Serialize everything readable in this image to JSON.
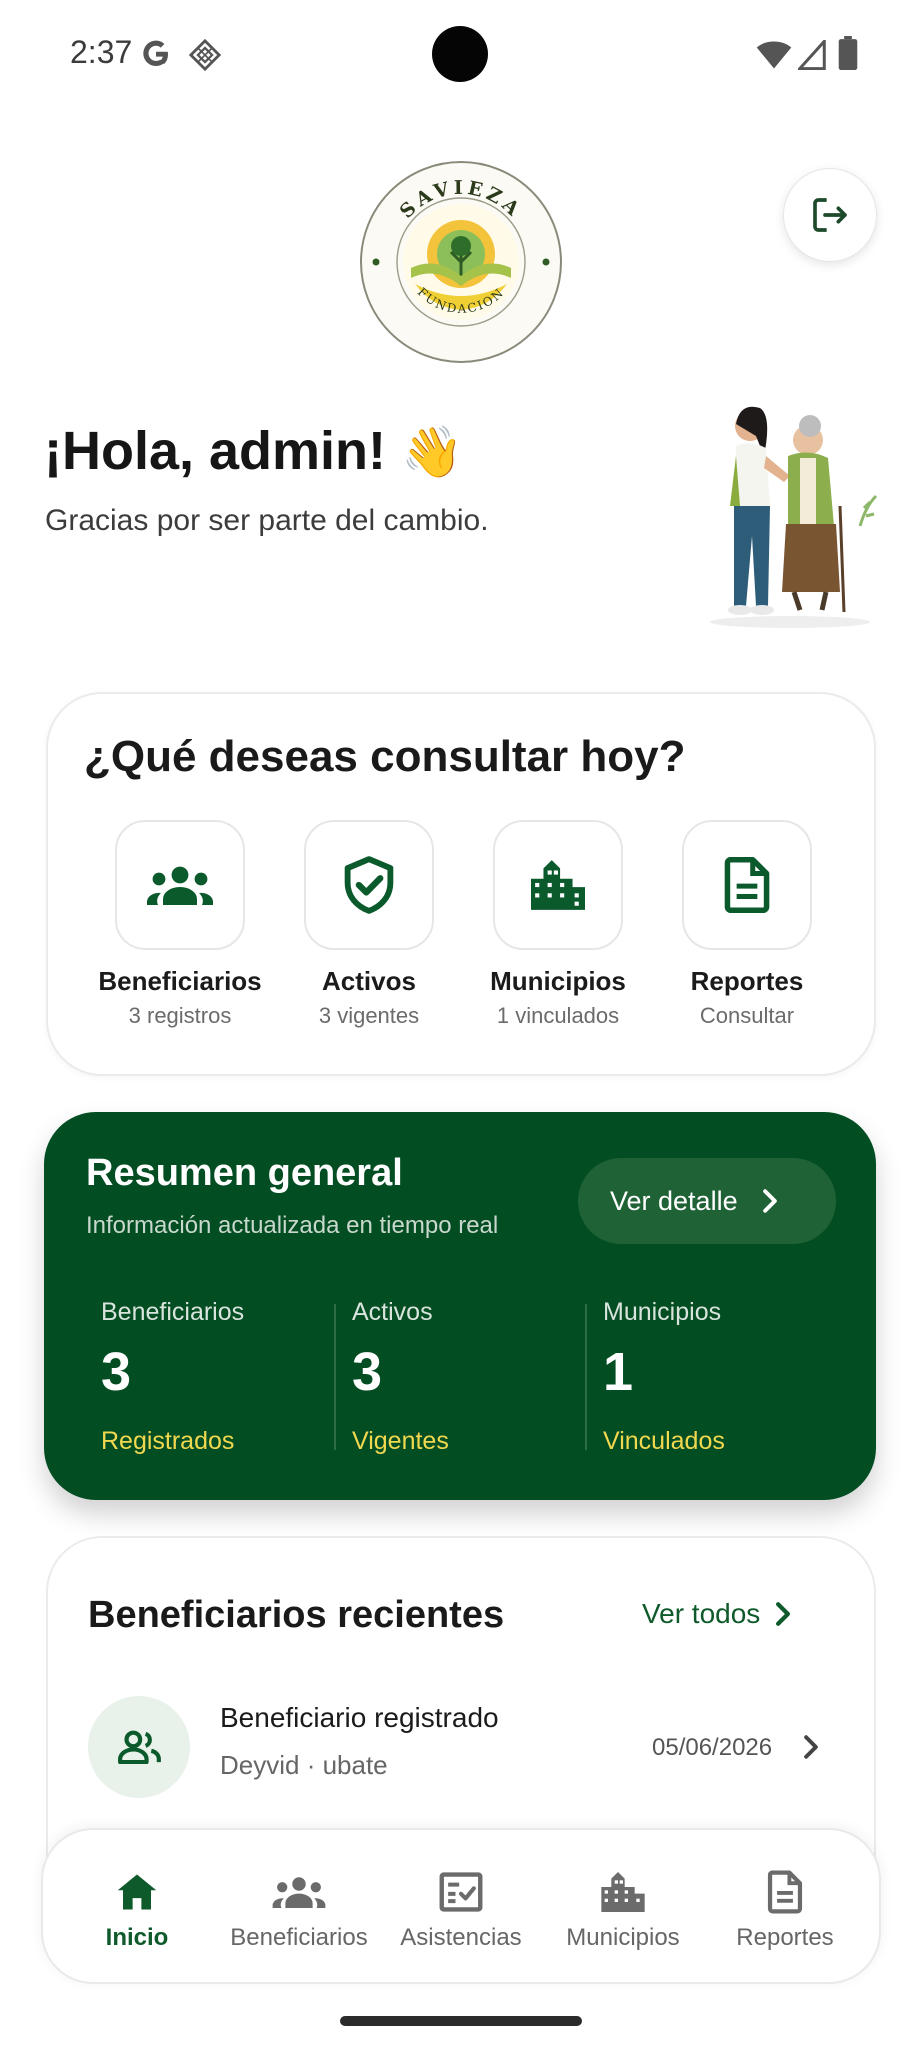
{
  "status_bar": {
    "time": "2:37",
    "icons": [
      "google-g-icon",
      "diamond-icon",
      "wifi-icon",
      "signal-icon",
      "battery-icon"
    ]
  },
  "header": {
    "logo": {
      "top_text": "SAVIEZA",
      "bottom_text": "FUNDACION"
    },
    "logout_icon": "logout-icon"
  },
  "greeting": {
    "title": "¡Hola, admin!",
    "emoji": "👋",
    "subtitle": "Gracias por ser parte del cambio."
  },
  "query": {
    "title": "¿Qué deseas consultar hoy?",
    "shortcuts": [
      {
        "icon": "group-icon",
        "label": "Beneficiarios",
        "sub": "3 registros"
      },
      {
        "icon": "shield-check-icon",
        "label": "Activos",
        "sub": "3 vigentes"
      },
      {
        "icon": "city-buildings-icon",
        "label": "Municipios",
        "sub": "1 vinculados"
      },
      {
        "icon": "document-icon",
        "label": "Reportes",
        "sub": "Consultar"
      }
    ]
  },
  "summary": {
    "title": "Resumen general",
    "subtitle": "Información actualizada en tiempo real",
    "detail_label": "Ver detalle",
    "stats": [
      {
        "label": "Beneficiarios",
        "value": "3",
        "caption": "Registrados"
      },
      {
        "label": "Activos",
        "value": "3",
        "caption": "Vigentes"
      },
      {
        "label": "Municipios",
        "value": "1",
        "caption": "Vinculados"
      }
    ]
  },
  "recent": {
    "title": "Beneficiarios recientes",
    "see_all": "Ver todos",
    "items": [
      {
        "name": "Beneficiario registrado",
        "meta": "Deyvid · ubate",
        "date": "05/06/2026"
      }
    ]
  },
  "bottom_nav": {
    "items": [
      {
        "icon": "home-icon",
        "label": "Inicio",
        "active": true
      },
      {
        "icon": "group-icon",
        "label": "Beneficiarios",
        "active": false
      },
      {
        "icon": "checklist-icon",
        "label": "Asistencias",
        "active": false
      },
      {
        "icon": "city-buildings-icon",
        "label": "Municipios",
        "active": false
      },
      {
        "icon": "document-icon",
        "label": "Reportes",
        "active": false
      }
    ]
  },
  "colors": {
    "primary": "#034d23",
    "accent_yellow": "#f2d84f",
    "text": "#1b1b1b",
    "muted": "#666666"
  }
}
